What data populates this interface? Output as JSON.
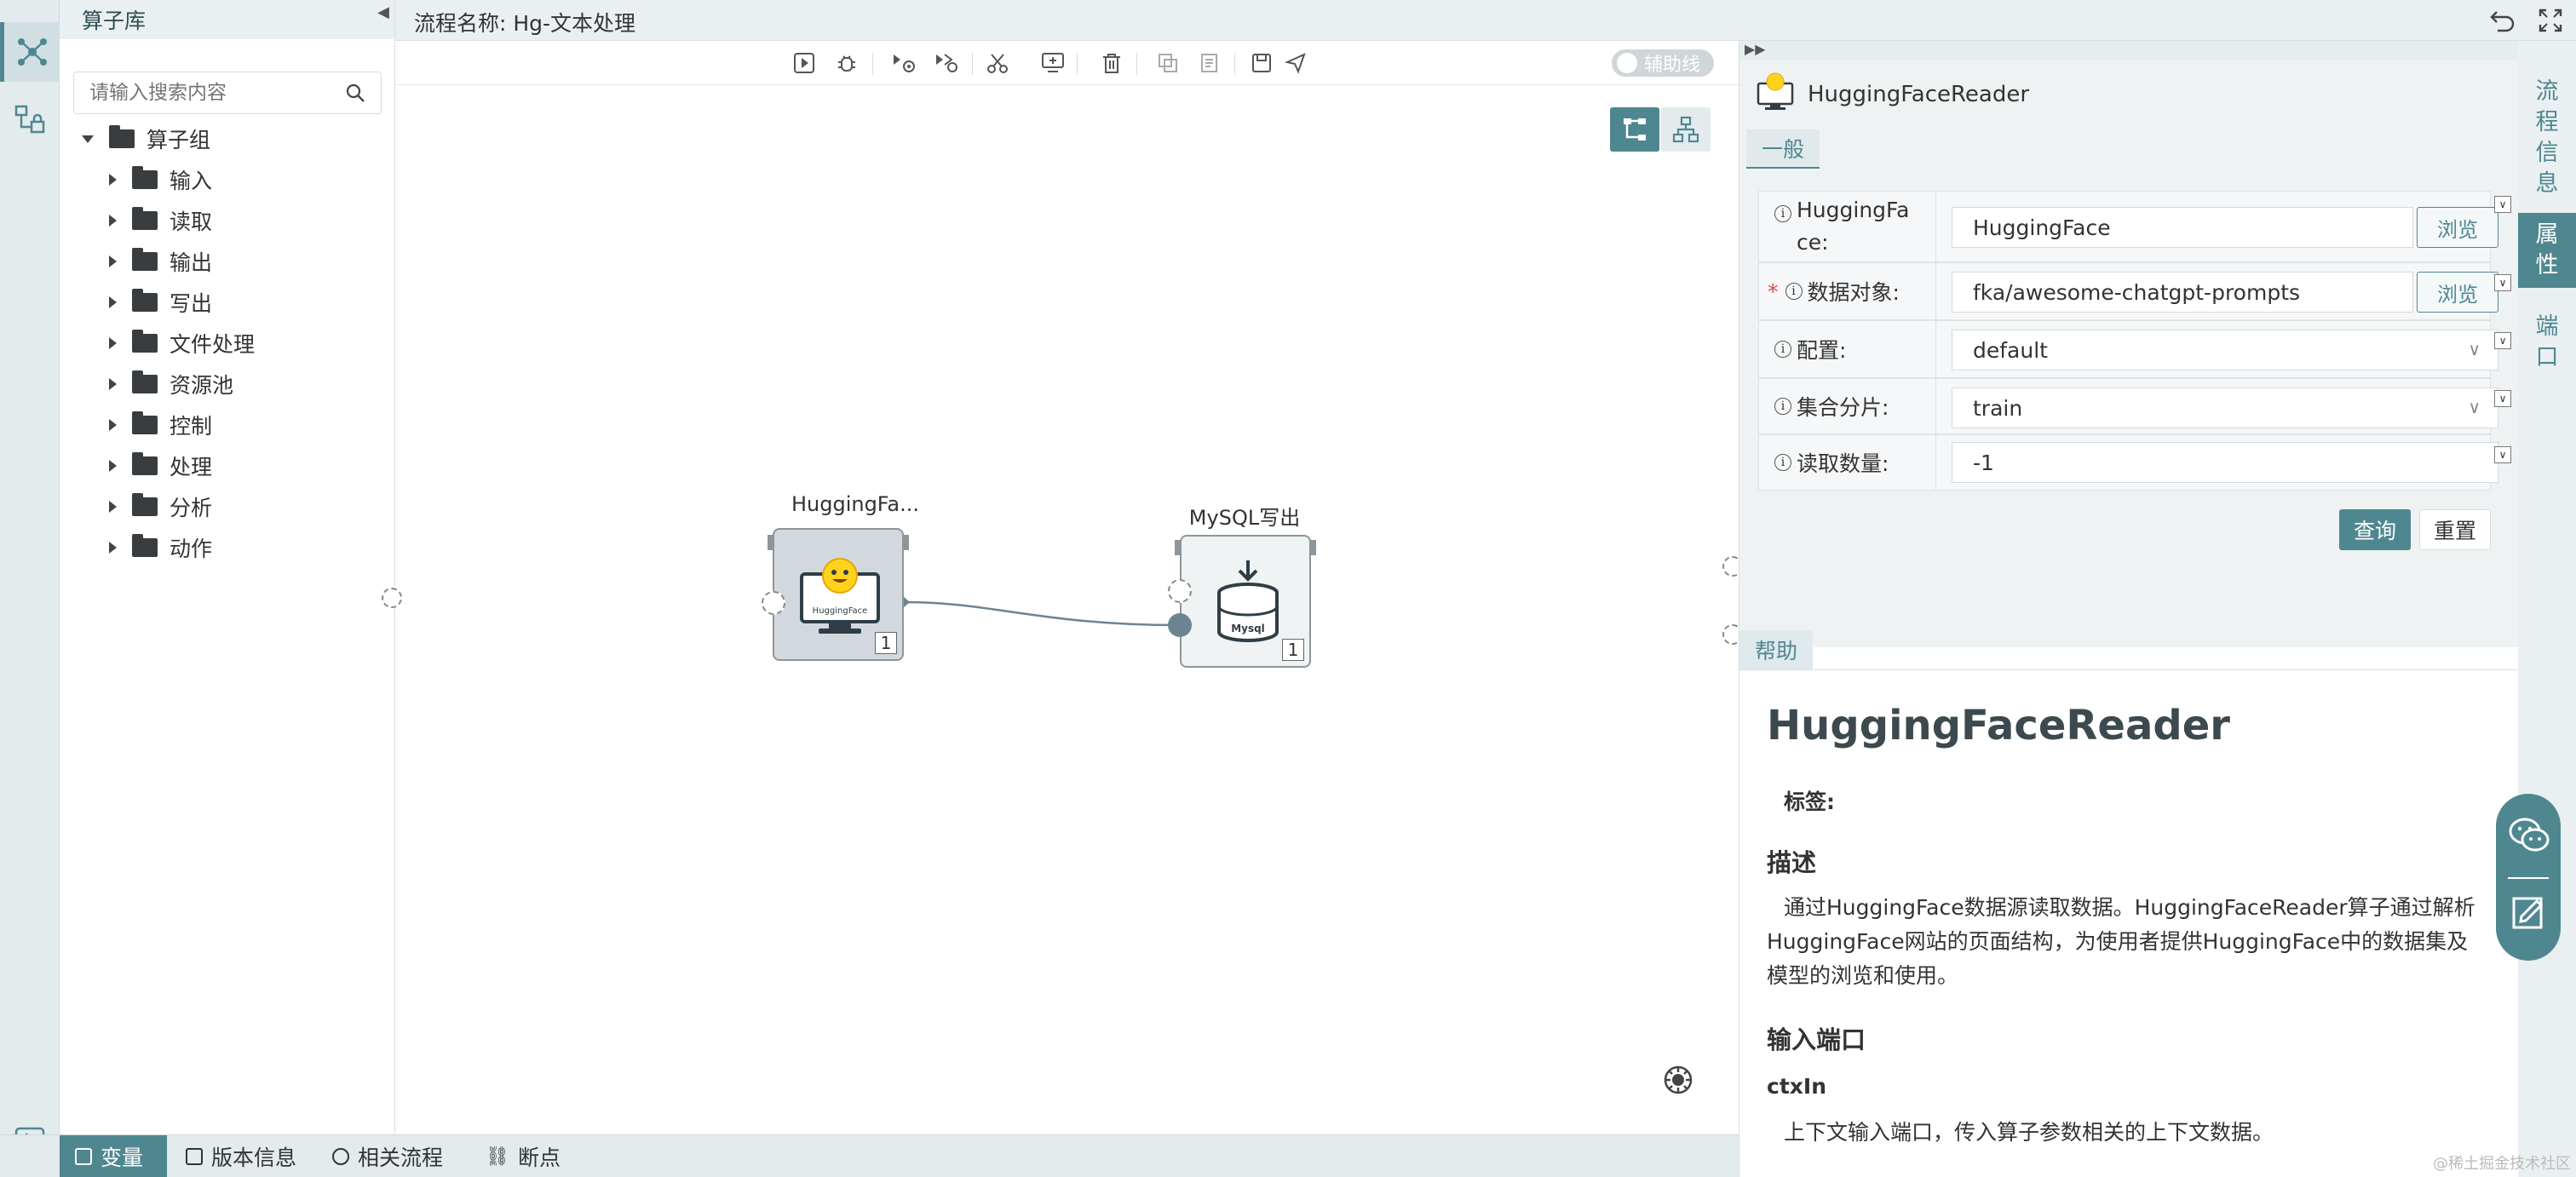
{
  "library": {
    "title": "算子库",
    "search_placeholder": "请输入搜索内容",
    "root": "算子组",
    "groups": [
      "输入",
      "读取",
      "输出",
      "写出",
      "文件处理",
      "资源池",
      "控制",
      "处理",
      "分析",
      "动作"
    ]
  },
  "topbar": {
    "flow_title": "流程名称: Hg-文本处理"
  },
  "toolbar": {
    "guide_toggle_label": "辅助线",
    "guide_toggle_on": false
  },
  "canvas": {
    "nodes": [
      {
        "label": "HuggingFa...",
        "logo_text": "HuggingFace",
        "count": "1"
      },
      {
        "label": "MySQL写出",
        "logo_text": "Mysql",
        "count": "1"
      }
    ]
  },
  "properties": {
    "component_title": "HuggingFaceReader",
    "tab_general": "一般",
    "rows": [
      {
        "label": "HuggingFa",
        "label2": "ce:",
        "value": "HuggingFace",
        "button": "浏览",
        "required": false
      },
      {
        "label": "数据对象:",
        "value": "fka/awesome-chatgpt-prompts",
        "button": "浏览",
        "required": true
      },
      {
        "label": "配置:",
        "value": "default",
        "dropdown": true
      },
      {
        "label": "集合分片:",
        "value": "train",
        "dropdown": true
      },
      {
        "label": "读取数量:",
        "value": "-1"
      }
    ],
    "query_button": "查询",
    "reset_button": "重置",
    "required_mark": "*"
  },
  "help": {
    "tab": "帮助",
    "title": "HuggingFaceReader",
    "tags_label": "标签:",
    "desc_heading": "描述",
    "desc_line1": "通过HuggingFace数据源读取数据。HuggingFaceReader算子通过解析",
    "desc_line2": "HuggingFace网站的页面结构，为使用者提供HuggingFace中的数据集及",
    "desc_line3": "模型的浏览和使用。",
    "input_port_heading": "输入端口",
    "port_name": "ctxIn",
    "port_desc": "上下文输入端口，传入算子参数相关的上下文数据。"
  },
  "vertical_tabs": [
    {
      "label": "流程信息",
      "chars": [
        "流",
        "程",
        "信",
        "息"
      ]
    },
    {
      "label": "属性",
      "chars": [
        "属",
        "性"
      ]
    },
    {
      "label": "端口",
      "chars": [
        "端",
        "口"
      ]
    }
  ],
  "bottombar": {
    "items": [
      "变量",
      "版本信息",
      "相关流程",
      "断点"
    ]
  },
  "watermark": "@稀土掘金技术社区",
  "colors": {
    "accent": "#4f8790",
    "panel_bg": "#eaf0f1"
  }
}
